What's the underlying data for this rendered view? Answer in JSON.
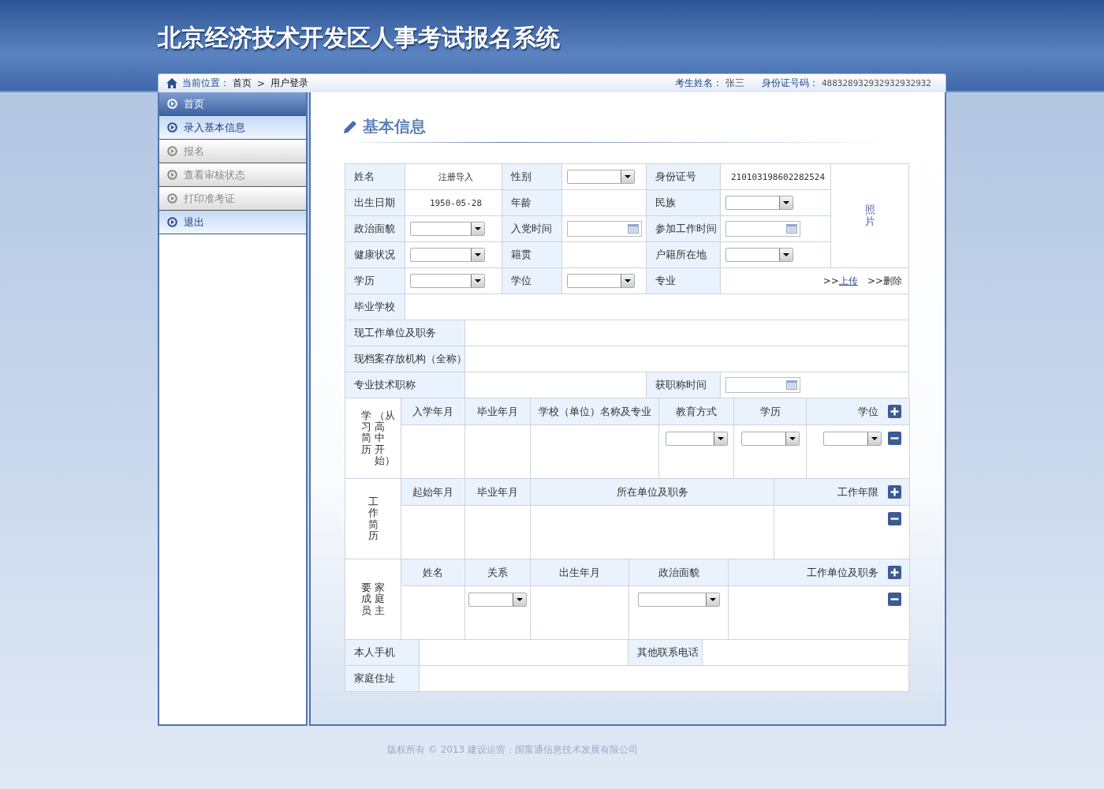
{
  "header": {
    "title": "北京经济技术开发区人事考试报名系统"
  },
  "breadcrumb": {
    "label": "当前位置：",
    "items": [
      "首页",
      "用户登录"
    ],
    "separator": ">"
  },
  "user": {
    "name_label": "考生姓名：",
    "name": "张三",
    "id_label": "身份证号码：",
    "id": "488328932932932932932"
  },
  "sidebar": [
    {
      "label": "首页",
      "selected": true,
      "disabled": false
    },
    {
      "label": "录入基本信息",
      "selected": false,
      "disabled": false
    },
    {
      "label": "报名",
      "selected": false,
      "disabled": true
    },
    {
      "label": "查看审核状态",
      "selected": false,
      "disabled": true
    },
    {
      "label": "打印准考证",
      "selected": false,
      "disabled": true
    },
    {
      "label": "退出",
      "selected": false,
      "disabled": false
    }
  ],
  "section_title": "基本信息",
  "basic": {
    "rows": [
      [
        {
          "kind": "label",
          "text": "姓名"
        },
        {
          "kind": "text",
          "text": "注册导入"
        },
        {
          "kind": "label",
          "text": "性别"
        },
        {
          "kind": "select"
        },
        {
          "kind": "label",
          "text": "身份证号"
        },
        {
          "kind": "text",
          "text": "210103198602282524"
        }
      ],
      [
        {
          "kind": "label",
          "text": "出生日期"
        },
        {
          "kind": "text",
          "text": "1950-05-28"
        },
        {
          "kind": "label",
          "text": "年龄"
        },
        {
          "kind": "blank"
        },
        {
          "kind": "label",
          "text": "民族"
        },
        {
          "kind": "select"
        }
      ],
      [
        {
          "kind": "label",
          "text": "政治面貌"
        },
        {
          "kind": "select"
        },
        {
          "kind": "label",
          "text": "入党时间"
        },
        {
          "kind": "date"
        },
        {
          "kind": "label",
          "text": "参加工作时间"
        },
        {
          "kind": "date"
        }
      ],
      [
        {
          "kind": "label",
          "text": "健康状况"
        },
        {
          "kind": "select"
        },
        {
          "kind": "label",
          "text": "籍贯"
        },
        {
          "kind": "blank"
        },
        {
          "kind": "label",
          "text": "户籍所在地"
        },
        {
          "kind": "select"
        }
      ],
      [
        {
          "kind": "label",
          "text": "学历"
        },
        {
          "kind": "select"
        },
        {
          "kind": "label",
          "text": "学位"
        },
        {
          "kind": "select"
        },
        {
          "kind": "label",
          "text": "专业"
        },
        {
          "kind": "links"
        }
      ]
    ],
    "photo": "照片",
    "links": [
      {
        "prefix": ">>",
        "label": "上传",
        "underline": true
      },
      {
        "prefix": ">>",
        "label": "删除",
        "underline": false
      }
    ]
  },
  "extra_rows": [
    {
      "kind": "short",
      "label": "毕业学校"
    },
    {
      "kind": "long",
      "label": "现工作单位及职务"
    },
    {
      "kind": "long",
      "label": "现档案存放机构（全称）"
    },
    {
      "kind": "split",
      "label": "专业技术职称",
      "label2": "获职称时间"
    }
  ],
  "histories": [
    {
      "title_lines": [
        "学习简历",
        "（从高中开始）"
      ],
      "columns": [
        {
          "label": "入学年月",
          "kind": "blank"
        },
        {
          "label": "毕业年月",
          "kind": "blank"
        },
        {
          "label": "学校（单位）名称及专业",
          "kind": "blank"
        },
        {
          "label": "教育方式",
          "kind": "select"
        },
        {
          "label": "学历",
          "kind": "select"
        },
        {
          "label": "学位",
          "kind": "select"
        }
      ]
    },
    {
      "title_lines": [
        "工作简历"
      ],
      "columns": [
        {
          "label": "起始年月",
          "kind": "blank"
        },
        {
          "label": "毕业年月",
          "kind": "blank"
        },
        {
          "label": "所在单位及职务",
          "kind": "blank"
        },
        {
          "label": "工作年限",
          "kind": "blank"
        }
      ]
    },
    {
      "title_lines": [
        "要成员",
        "家庭主"
      ],
      "columns": [
        {
          "label": "姓名",
          "kind": "blank"
        },
        {
          "label": "关系",
          "kind": "select"
        },
        {
          "label": "出生年月",
          "kind": "blank"
        },
        {
          "label": "政治面貌",
          "kind": "select"
        },
        {
          "label": "工作单位及职务",
          "kind": "blank"
        }
      ]
    }
  ],
  "contacts": [
    {
      "label": "本人手机",
      "label2": "其他联系电话"
    },
    {
      "label": "家庭住址"
    }
  ],
  "footer": "版权所有 © 2013 建设运营：国富通信息技术发展有限公司"
}
